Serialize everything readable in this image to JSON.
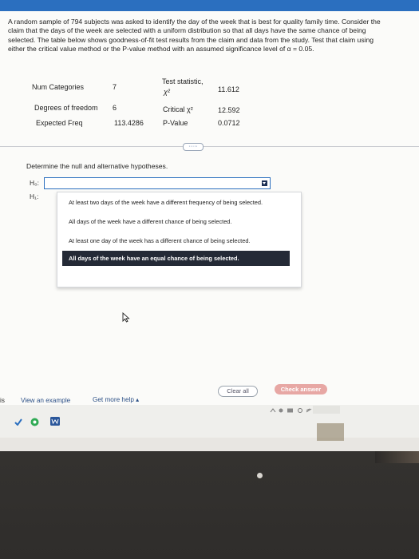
{
  "question": {
    "text": "A random sample of 794 subjects was asked to identify the day of the week that is best for quality family time. Consider the claim that the days of the week are selected with a uniform distribution so that all days have the same chance of being selected. The table below shows goodness-of-fit test results from the claim and data from the study. Test that claim using either the critical value method or the P-value method with an assumed significance level of α = 0.05."
  },
  "stats": {
    "num_categories_label": "Num Categories",
    "num_categories_value": "7",
    "dof_label": "Degrees of freedom",
    "dof_value": "6",
    "expected_label": "Expected Freq",
    "expected_value": "113.4286",
    "test_stat_label": "Test statistic,",
    "test_stat_symbol": "χ²",
    "test_stat_value": "11.612",
    "critical_label": "Critical χ²",
    "critical_value": "12.592",
    "pvalue_label": "P-Value",
    "pvalue_value": "0.0712"
  },
  "expand_button": "·····",
  "prompt": "Determine the null and alternative hypotheses.",
  "hypotheses": {
    "h0_label": "H₀:",
    "h1_label": "H₁:"
  },
  "dropdown": {
    "options": [
      "At least two days of the week have a different frequency of being selected.",
      "All days of the week have a different chance of being selected.",
      "At least one day of the week has a different chance of being selected.",
      "All days of the week have an equal chance of being selected."
    ],
    "highlighted_index": 3
  },
  "footer": {
    "left_cut": "is",
    "view_example": "View an example",
    "get_more_help": "Get more help ▴",
    "clear_all": "Clear all",
    "check_answer": "Check answer"
  },
  "colors": {
    "accent": "#2b6fbf",
    "check_answer_bg": "#e7a7a4",
    "highlight_bg": "#242a36"
  },
  "icons": [
    "checkmark-icon",
    "chrome-icon",
    "word-icon",
    "mouse-pointer-icon"
  ]
}
